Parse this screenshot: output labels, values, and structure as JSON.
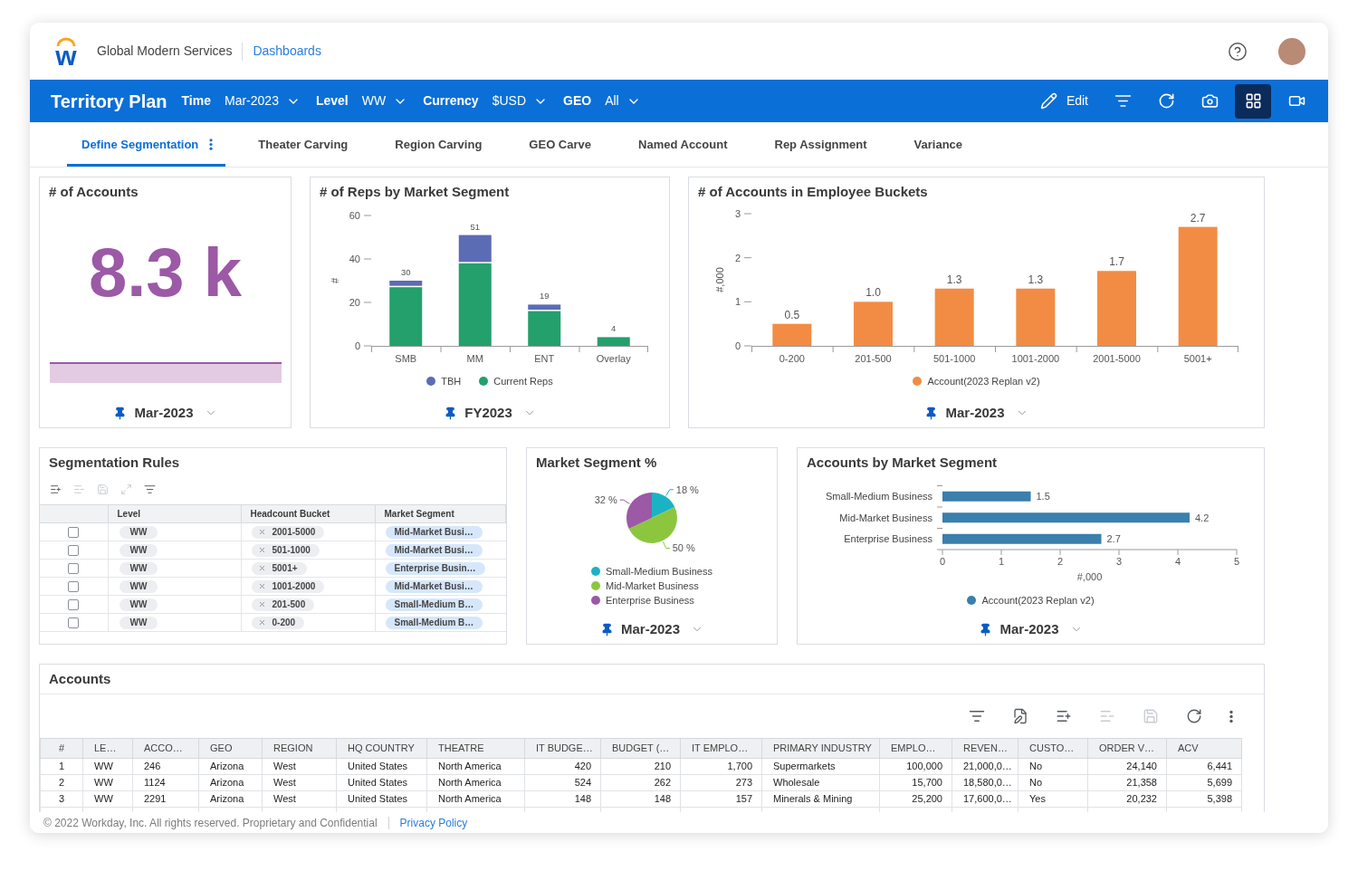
{
  "header": {
    "logo_letter": "w",
    "org_name": "Global Modern Services",
    "link": "Dashboards"
  },
  "toolbar": {
    "title": "Territory Plan",
    "filters": [
      {
        "label": "Time",
        "value": "Mar-2023"
      },
      {
        "label": "Level",
        "value": "WW"
      },
      {
        "label": "Currency",
        "value": "$USD"
      },
      {
        "label": "GEO",
        "value": "All"
      }
    ],
    "tools": [
      {
        "kind": "edit",
        "label": "Edit",
        "selected": false
      },
      {
        "kind": "filter",
        "selected": false
      },
      {
        "kind": "refresh",
        "selected": false
      },
      {
        "kind": "camera",
        "selected": false
      },
      {
        "kind": "grid",
        "selected": true
      },
      {
        "kind": "video",
        "selected": false
      }
    ]
  },
  "tabs": [
    {
      "label": "Define Segmentation",
      "selected": true
    },
    {
      "label": "Theater Carving",
      "selected": false
    },
    {
      "label": "Region Carving",
      "selected": false
    },
    {
      "label": "GEO Carve",
      "selected": false
    },
    {
      "label": "Named Account",
      "selected": false
    },
    {
      "label": "Rep Assignment",
      "selected": false
    },
    {
      "label": "Variance",
      "selected": false
    }
  ],
  "accounts_count": {
    "title": "# of Accounts",
    "value": "8.3 k",
    "period": "Mar-2023"
  },
  "reps_chart": {
    "title": "# of Reps by Market Segment",
    "chart_data": {
      "type": "bar",
      "stacked": true,
      "ylabel": "#",
      "categories": [
        "SMB",
        "MM",
        "ENT",
        "Overlay"
      ],
      "series": [
        {
          "name": "TBH",
          "color": "#5b6cb5",
          "values": [
            3,
            13,
            3,
            0
          ]
        },
        {
          "name": "Current Reps",
          "color": "#23a06c",
          "values": [
            27,
            38,
            16,
            4
          ]
        }
      ],
      "ylim": [
        0,
        60
      ],
      "yticks": [
        0,
        20,
        40,
        60
      ],
      "value_labels": [
        "30",
        "51",
        "19",
        "4"
      ],
      "legend": "bottom"
    },
    "period": "FY2023"
  },
  "buckets_chart": {
    "title": "# of Accounts in Employee Buckets",
    "chart_data": {
      "type": "bar",
      "ylabel": "#,000",
      "categories": [
        "0-200",
        "201-500",
        "501-1000",
        "1001-2000",
        "2001-5000",
        "5001+"
      ],
      "series": [
        {
          "name": "Account(2023 Replan v2)",
          "color": "#f28c44",
          "values": [
            0.5,
            1.0,
            1.3,
            1.3,
            1.7,
            2.7
          ]
        }
      ],
      "ylim": [
        0,
        3
      ],
      "yticks": [
        0,
        1,
        2,
        3
      ],
      "value_labels": [
        "0.5",
        "1.0",
        "1.3",
        "1.3",
        "1.7",
        "2.7"
      ],
      "legend": "bottom"
    },
    "period": "Mar-2023"
  },
  "segmentation_rules": {
    "title": "Segmentation Rules",
    "tools": [
      {
        "kind": "list-add",
        "disabled": false
      },
      {
        "kind": "list-remove",
        "disabled": true
      },
      {
        "kind": "save",
        "disabled": true
      },
      {
        "kind": "expand",
        "disabled": true
      },
      {
        "kind": "filter",
        "disabled": false
      }
    ],
    "columns": [
      "Level",
      "Headcount Bucket",
      "Market Segment"
    ],
    "rows": [
      {
        "checked": false,
        "level": "WW",
        "bucket": "2001-5000",
        "segment": "Mid-Market Busi…"
      },
      {
        "checked": false,
        "level": "WW",
        "bucket": "501-1000",
        "segment": "Mid-Market Busi…"
      },
      {
        "checked": false,
        "level": "WW",
        "bucket": "5001+",
        "segment": "Enterprise Busin…"
      },
      {
        "checked": false,
        "level": "WW",
        "bucket": "1001-2000",
        "segment": "Mid-Market Busi…"
      },
      {
        "checked": false,
        "level": "WW",
        "bucket": "201-500",
        "segment": "Small-Medium B…"
      },
      {
        "checked": false,
        "level": "WW",
        "bucket": "0-200",
        "segment": "Small-Medium B…"
      }
    ]
  },
  "segment_share": {
    "title": "Market Segment %",
    "chart_data": {
      "type": "pie",
      "categories": [
        "Small-Medium Business",
        "Mid-Market Business",
        "Enterprise Business"
      ],
      "values": [
        18,
        50,
        32
      ],
      "colors": [
        "#1bb3c4",
        "#8cc63f",
        "#9b59a6"
      ],
      "value_labels": [
        "18 %",
        "50 %",
        "32 %"
      ],
      "legend": "bottom"
    },
    "period": "Mar-2023"
  },
  "segment_accounts": {
    "title": "Accounts by Market Segment",
    "chart_data": {
      "type": "bar",
      "orientation": "horizontal",
      "xlabel": "#,000",
      "categories": [
        "Small-Medium Business",
        "Mid-Market Business",
        "Enterprise Business"
      ],
      "series": [
        {
          "name": "Account(2023 Replan v2)",
          "color": "#3a7fad",
          "values": [
            1.5,
            4.2,
            2.7
          ]
        }
      ],
      "xlim": [
        0,
        5
      ],
      "xticks": [
        0,
        1,
        2,
        3,
        4,
        5
      ],
      "value_labels": [
        "1.5",
        "4.2",
        "2.7"
      ],
      "legend": "bottom"
    },
    "period": "Mar-2023"
  },
  "accounts": {
    "title": "Accounts",
    "tools": [
      {
        "kind": "filter",
        "disabled": false
      },
      {
        "kind": "edit",
        "disabled": false
      },
      {
        "kind": "add-row",
        "disabled": false
      },
      {
        "kind": "remove-row",
        "disabled": true
      },
      {
        "kind": "save",
        "disabled": true
      },
      {
        "kind": "refresh",
        "disabled": false
      },
      {
        "kind": "more",
        "disabled": false
      }
    ],
    "columns": [
      {
        "label": "#",
        "kind": "index"
      },
      {
        "label": "LE…",
        "kind": "text"
      },
      {
        "label": "ACCO…",
        "kind": "text"
      },
      {
        "label": "GEO",
        "kind": "text"
      },
      {
        "label": "REGION",
        "kind": "text"
      },
      {
        "label": "HQ COUNTRY",
        "kind": "text"
      },
      {
        "label": "THEATRE",
        "kind": "text"
      },
      {
        "label": "IT BUDGE…",
        "kind": "number"
      },
      {
        "label": "BUDGET (…",
        "kind": "number"
      },
      {
        "label": "IT EMPLO…",
        "kind": "number"
      },
      {
        "label": "PRIMARY INDUSTRY",
        "kind": "text"
      },
      {
        "label": "EMPLO…",
        "kind": "number"
      },
      {
        "label": "REVEN…",
        "kind": "text"
      },
      {
        "label": "CUSTO…",
        "kind": "text"
      },
      {
        "label": "ORDER V…",
        "kind": "number"
      },
      {
        "label": "ACV",
        "kind": "number"
      }
    ],
    "rows": [
      [
        "1",
        "WW",
        "246",
        "Arizona",
        "West",
        "United States",
        "North America",
        "420",
        "210",
        "1,700",
        "Supermarkets",
        "100,000",
        "21,000,0…",
        "No",
        "24,140",
        "6,441"
      ],
      [
        "2",
        "WW",
        "1124",
        "Arizona",
        "West",
        "United States",
        "North America",
        "524",
        "262",
        "273",
        "Wholesale",
        "15,700",
        "18,580,0…",
        "No",
        "21,358",
        "5,699"
      ],
      [
        "3",
        "WW",
        "2291",
        "Arizona",
        "West",
        "United States",
        "North America",
        "148",
        "148",
        "157",
        "Minerals & Mining",
        "25,200",
        "17,600,0…",
        "Yes",
        "20,232",
        "5,398"
      ]
    ]
  },
  "footer": {
    "copyright": "© 2022 Workday, Inc. All rights reserved. Proprietary and Confidential",
    "link": "Privacy Policy"
  }
}
